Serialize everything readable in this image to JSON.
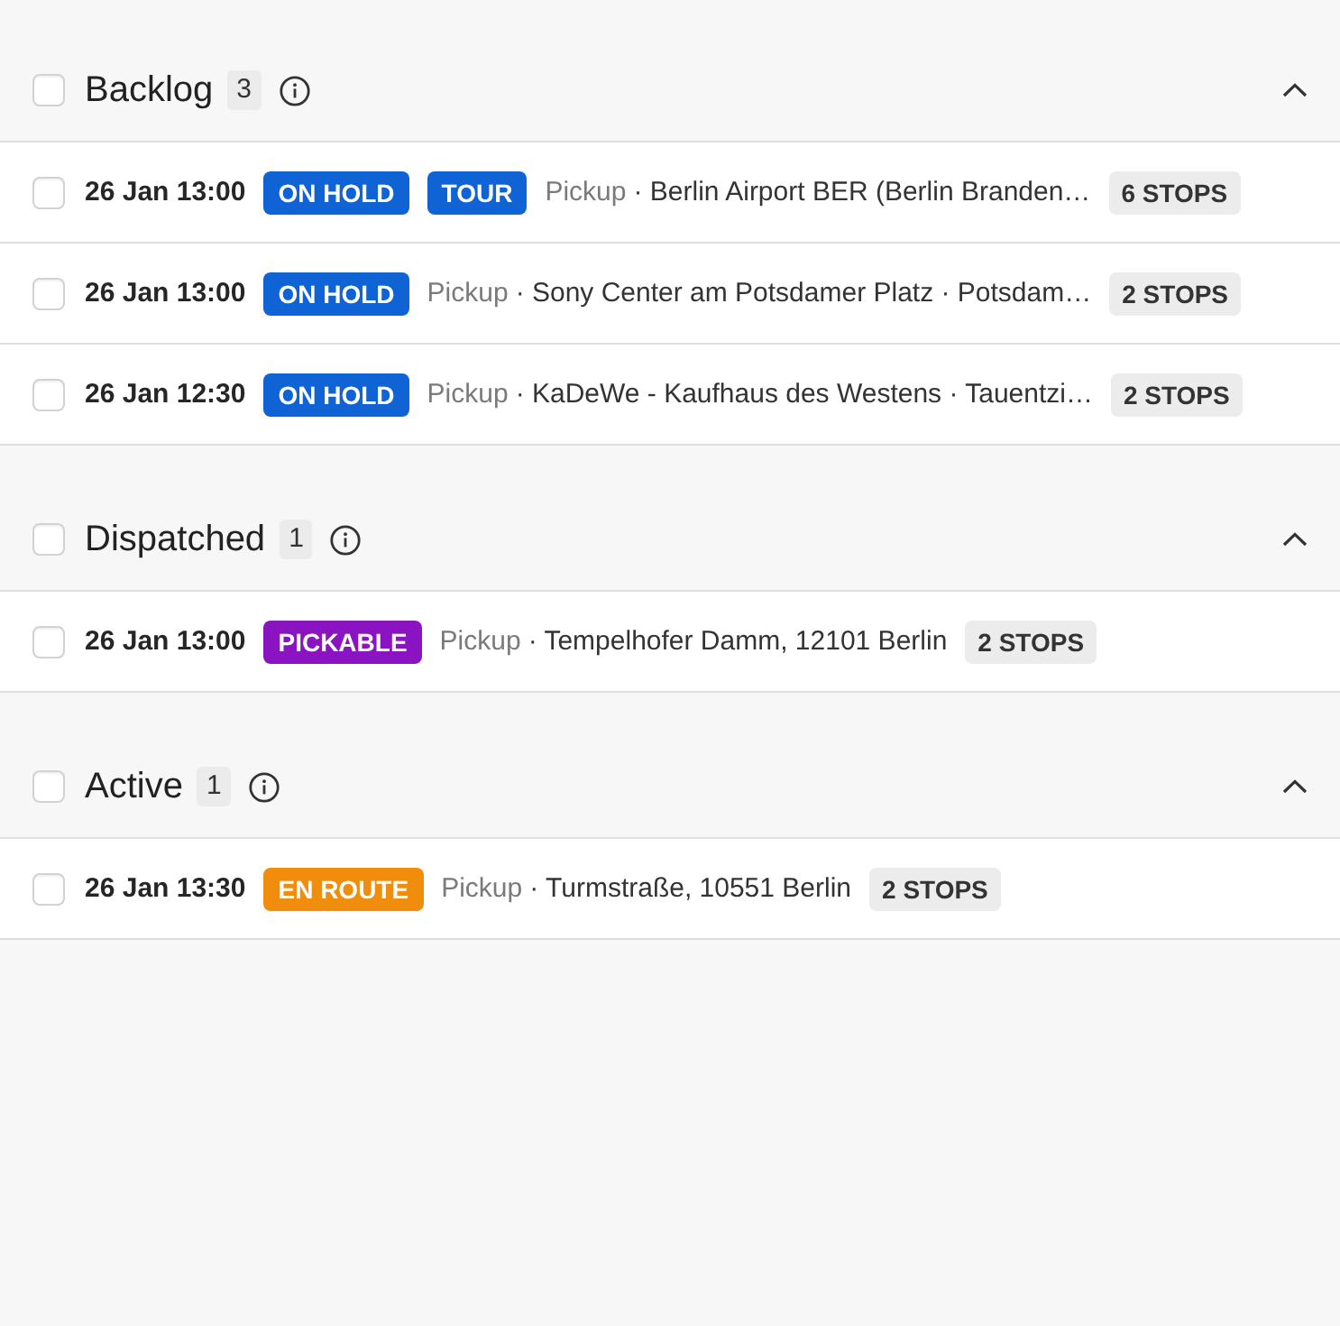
{
  "sections": [
    {
      "title": "Backlog",
      "count": "3",
      "checked": false,
      "expanded": true,
      "rows": [
        {
          "checked": false,
          "time": "26 Jan 13:00",
          "tags": [
            {
              "label": "ON HOLD",
              "color": "#0f63d5"
            },
            {
              "label": "TOUR",
              "color": "#0f63d5"
            }
          ],
          "type": "Pickup",
          "address": "· Berlin Airport BER (Berlin Branden…",
          "stops": "6 STOPS"
        },
        {
          "checked": false,
          "time": "26 Jan 13:00",
          "tags": [
            {
              "label": "ON HOLD",
              "color": "#0f63d5"
            }
          ],
          "type": "Pickup",
          "address": "· Sony Center am Potsdamer Platz · Potsdam…",
          "stops": "2 STOPS"
        },
        {
          "checked": false,
          "time": "26 Jan 12:30",
          "tags": [
            {
              "label": "ON HOLD",
              "color": "#0f63d5"
            }
          ],
          "type": "Pickup",
          "address": "· KaDeWe - Kaufhaus des Westens · Tauentzi…",
          "stops": "2 STOPS"
        }
      ]
    },
    {
      "title": "Dispatched",
      "count": "1",
      "checked": false,
      "expanded": true,
      "rows": [
        {
          "checked": false,
          "time": "26 Jan 13:00",
          "tags": [
            {
              "label": "PICKABLE",
              "color": "#8a14c2"
            }
          ],
          "type": "Pickup",
          "address": "· Tempelhofer Damm, 12101 Berlin",
          "stops": "2 STOPS"
        }
      ]
    },
    {
      "title": "Active",
      "count": "1",
      "checked": false,
      "expanded": true,
      "rows": [
        {
          "checked": false,
          "time": "26 Jan 13:30",
          "tags": [
            {
              "label": "EN ROUTE",
              "color": "#f18d0c"
            }
          ],
          "type": "Pickup",
          "address": "· Turmstraße, 10551 Berlin",
          "stops": "2 STOPS"
        }
      ]
    }
  ]
}
